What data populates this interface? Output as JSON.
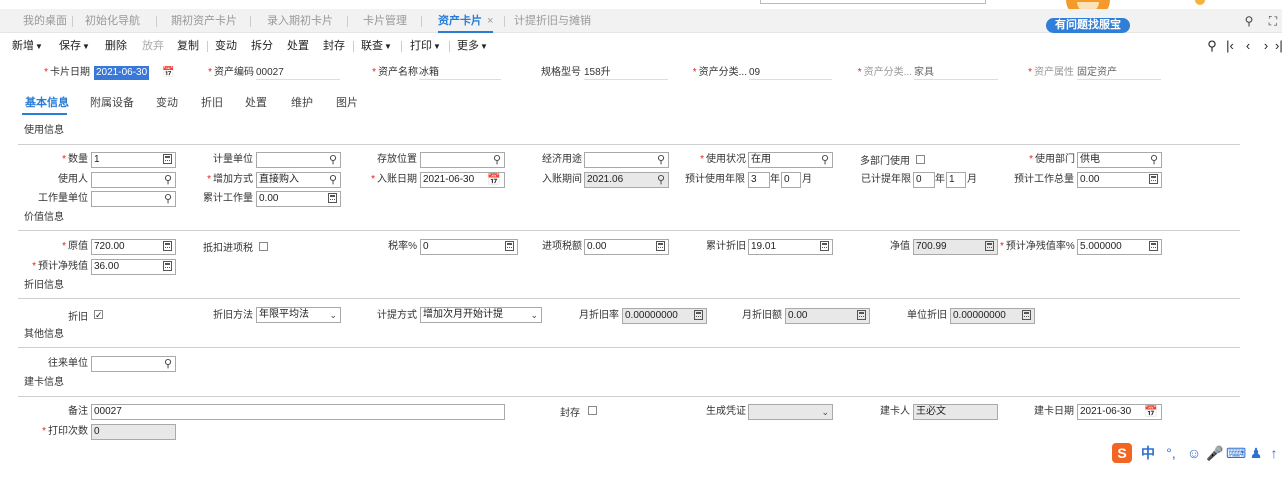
{
  "tabs": [
    {
      "label": "我的桌面"
    },
    {
      "label": "初始化导航"
    },
    {
      "label": "期初资产卡片"
    },
    {
      "label": "录入期初卡片"
    },
    {
      "label": "卡片管理"
    },
    {
      "label": "资产卡片",
      "close": "×"
    },
    {
      "label": "计提折旧与摊销"
    }
  ],
  "help_button": "有问题找服宝",
  "toolbar": {
    "new": "新增",
    "save": "保存",
    "delete": "删除",
    "discard": "放弃",
    "copy": "复制",
    "change": "变动",
    "split": "拆分",
    "dispose": "处置",
    "seal": "封存",
    "query": "联查",
    "print": "打印",
    "more": "更多"
  },
  "header": {
    "card_date_label": "卡片日期",
    "card_date": "2021-06-30",
    "asset_code_label": "资产编码",
    "asset_code": "00027",
    "asset_name_label": "资产名称",
    "asset_name": "冰箱",
    "spec_label": "规格型号",
    "spec": "158升",
    "category1_label": "资产分类...",
    "category1": "09",
    "category2_label": "资产分类...",
    "category2": "家具",
    "attr_label": "资产属性",
    "attr": "固定资产"
  },
  "subtabs": [
    "基本信息",
    "附属设备",
    "变动",
    "折旧",
    "处置",
    "维护",
    "图片"
  ],
  "sections": {
    "usage": "使用信息",
    "value": "价值信息",
    "depr": "折旧信息",
    "other": "其他信息",
    "build": "建卡信息"
  },
  "usage": {
    "qty_label": "数量",
    "qty": "1",
    "unit_label": "计量单位",
    "unit": "",
    "location_label": "存放位置",
    "location": "",
    "econ_label": "经济用途",
    "econ": "",
    "status_label": "使用状况",
    "status": "在用",
    "multi_dept_label": "多部门使用",
    "dept_label": "使用部门",
    "dept": "供电",
    "user_label": "使用人",
    "user": "",
    "add_method_label": "增加方式",
    "add_method": "直接购入",
    "entry_date_label": "入账日期",
    "entry_date": "2021-06-30",
    "entry_period_label": "入账期间",
    "entry_period": "2021.06",
    "est_years_label": "预计使用年限",
    "est_years": "3",
    "year_unit": "年",
    "est_months": "0",
    "month_unit": "月",
    "used_years_label": "已计提年限",
    "used_years": "0",
    "used_year_unit": "年",
    "used_months": "1",
    "used_month_unit": "月",
    "est_workload_label": "预计工作总量",
    "est_workload": "0.00",
    "work_unit_label": "工作量单位",
    "work_unit": "",
    "acc_workload_label": "累计工作量",
    "acc_workload": "0.00"
  },
  "value": {
    "orig_label": "原值",
    "orig": "720.00",
    "deduct_label": "抵扣进项税",
    "tax_rate_label": "税率%",
    "tax_rate": "0",
    "input_tax_label": "进项税额",
    "input_tax": "0.00",
    "acc_depr_label": "累计折旧",
    "acc_depr": "19.01",
    "net_label": "净值",
    "net": "700.99",
    "resid_rate_label": "预计净残值率%",
    "resid_rate": "5.000000",
    "resid_label": "预计净残值",
    "resid": "36.00"
  },
  "depr": {
    "depr_label": "折旧",
    "method_label": "折旧方法",
    "method": "年限平均法",
    "mode_label": "计提方式",
    "mode": "增加次月开始计提",
    "monthly_rate_label": "月折旧率",
    "monthly_rate": "0.00000000",
    "monthly_amt_label": "月折旧额",
    "monthly_amt": "0.00",
    "unit_depr_label": "单位折旧",
    "unit_depr": "0.00000000"
  },
  "other": {
    "partner_label": "往来单位",
    "partner": ""
  },
  "build": {
    "remark_label": "备注",
    "remark": "00027",
    "seal_label": "封存",
    "voucher_label": "生成凭证",
    "voucher": "",
    "creator_label": "建卡人",
    "creator": "王必文",
    "build_date_label": "建卡日期",
    "build_date": "2021-06-30",
    "print_count_label": "打印次数",
    "print_count": "0"
  },
  "ime": {
    "logo": "S",
    "lang": "中",
    "punct": "°,"
  },
  "colors": {
    "accent": "#2a7dd6",
    "required": "#e02020",
    "help": "#2f7fd8"
  }
}
